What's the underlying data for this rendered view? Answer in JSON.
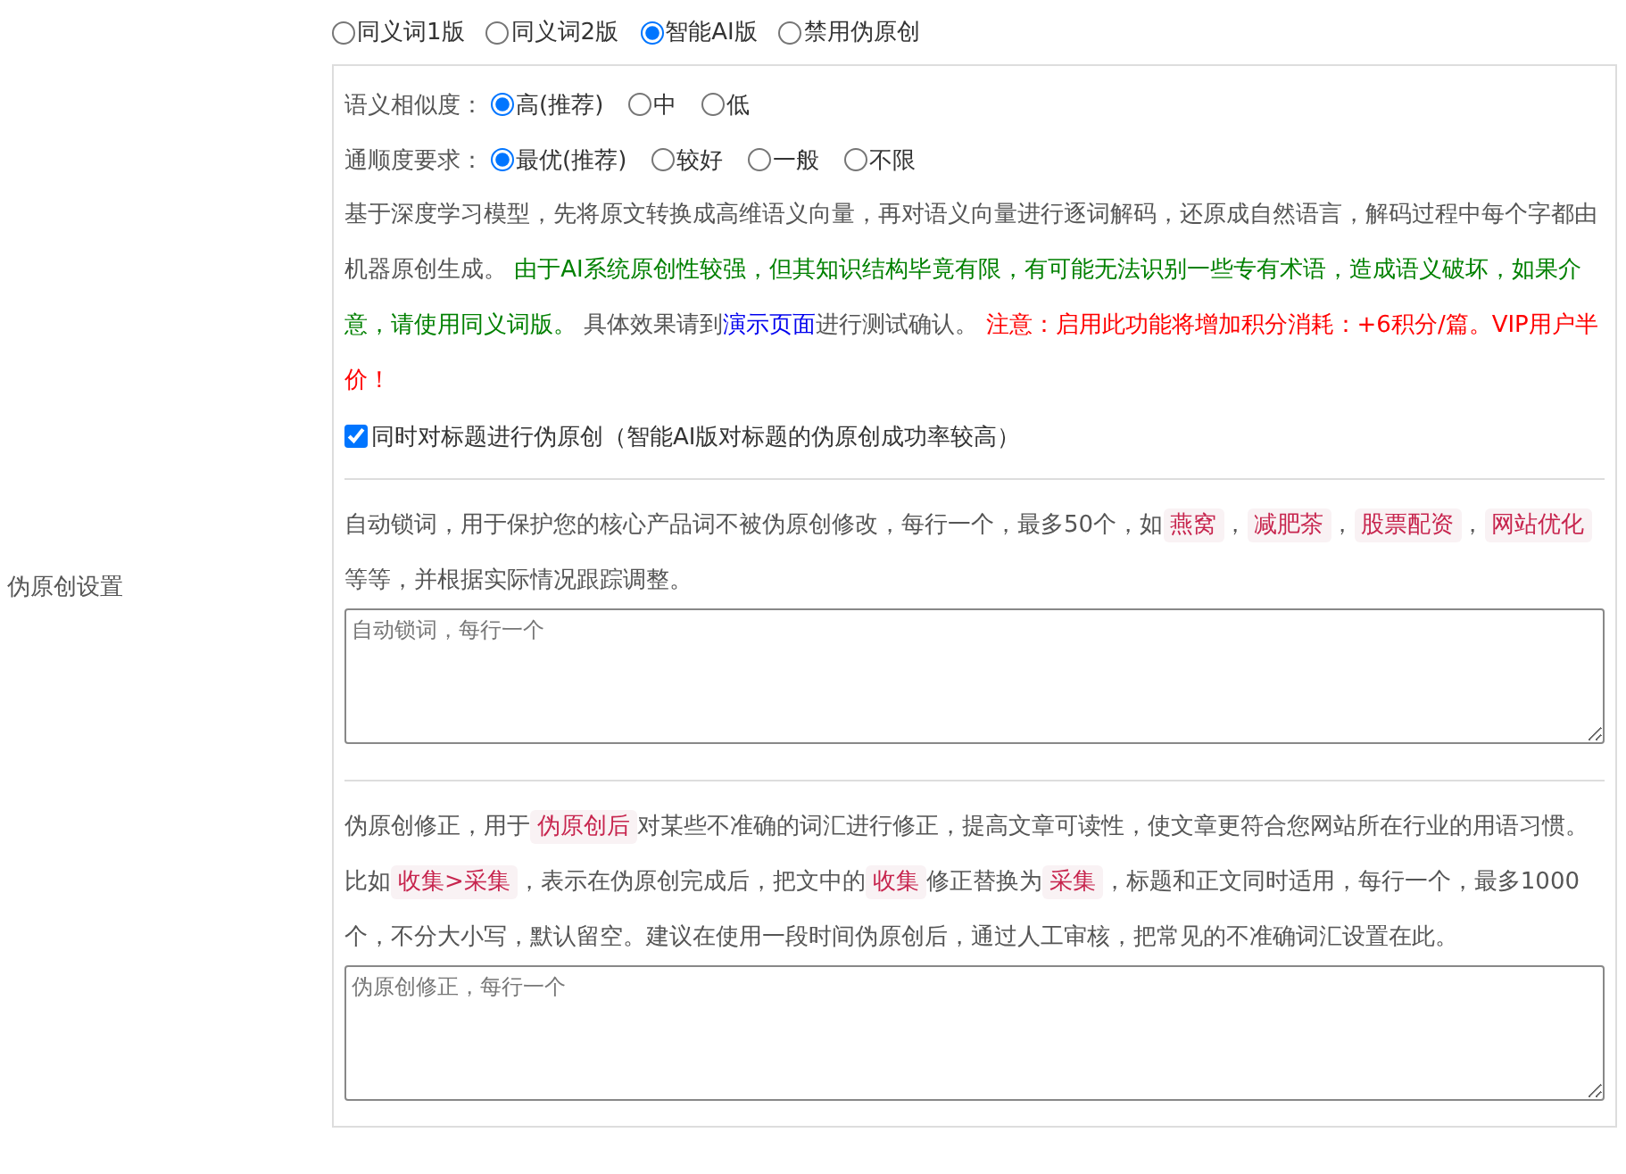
{
  "side_label": "伪原创设置",
  "modes": [
    {
      "label": "同义词1版",
      "selected": false
    },
    {
      "label": "同义词2版",
      "selected": false
    },
    {
      "label": "智能AI版",
      "selected": true
    },
    {
      "label": "禁用伪原创",
      "selected": false
    }
  ],
  "similarity": {
    "label": "语义相似度：",
    "options": [
      {
        "label": "高(推荐)",
        "selected": true
      },
      {
        "label": "中",
        "selected": false
      },
      {
        "label": "低",
        "selected": false
      }
    ]
  },
  "fluency": {
    "label": "通顺度要求：",
    "options": [
      {
        "label": "最优(推荐)",
        "selected": true
      },
      {
        "label": "较好",
        "selected": false
      },
      {
        "label": "一般",
        "selected": false
      },
      {
        "label": "不限",
        "selected": false
      }
    ]
  },
  "ai_note": [
    {
      "kind": "plain",
      "text": "基于深度学习模型，先将原文转换成高维语义向量，再对语义向量进行逐词解码，还原成自然语言，解码过程中每个字都由机器原创生成。 "
    },
    {
      "kind": "green",
      "text": "由于AI系统原创性较强，但其知识结构毕竟有限，有可能无法识别一些专有术语，造成语义破坏，如果介意，请使用同义词版。"
    },
    {
      "kind": "plain",
      "text": " 具体效果请到"
    },
    {
      "kind": "link",
      "text": "演示页面"
    },
    {
      "kind": "plain",
      "text": "进行测试确认。 "
    },
    {
      "kind": "red",
      "text": "注意：启用此功能将增加积分消耗：+6积分/篇。VIP用户半价！"
    }
  ],
  "title_option": {
    "label": "同时对标题进行伪原创（智能AI版对标题的伪原创成功率较高）",
    "checked": true
  },
  "lock_words": {
    "text": [
      {
        "kind": "plain",
        "text": "自动锁词，用于保护您的核心产品词不被伪原创修改，每行一个，最多50个，如"
      },
      {
        "kind": "tag",
        "text": "燕窝"
      },
      {
        "kind": "plain",
        "text": "，"
      },
      {
        "kind": "tag",
        "text": "减肥茶"
      },
      {
        "kind": "plain",
        "text": "，"
      },
      {
        "kind": "tag",
        "text": "股票配资"
      },
      {
        "kind": "plain",
        "text": "，"
      },
      {
        "kind": "tag",
        "text": "网站优化"
      },
      {
        "kind": "plain",
        "text": " 等等，并根据实际情况跟踪调整。"
      }
    ],
    "placeholder": "自动锁词，每行一个"
  },
  "correction": {
    "text": [
      {
        "kind": "plain",
        "text": "伪原创修正，用于"
      },
      {
        "kind": "tag",
        "text": "伪原创后"
      },
      {
        "kind": "plain",
        "text": "对某些不准确的词汇进行修正，提高文章可读性，使文章更符合您网站所在行业的用语习惯。比如"
      },
      {
        "kind": "tag",
        "text": "收集>采集"
      },
      {
        "kind": "plain",
        "text": "，表示在伪原创完成后，把文中的"
      },
      {
        "kind": "tag",
        "text": "收集"
      },
      {
        "kind": "plain",
        "text": "修正替换为"
      },
      {
        "kind": "tag",
        "text": "采集"
      },
      {
        "kind": "plain",
        "text": "，标题和正文同时适用，每行一个，最多1000个，不分大小写，默认留空。建议在使用一段时间伪原创后，通过人工审核，把常见的不准确词汇设置在此。"
      }
    ],
    "placeholder": "伪原创修正，每行一个"
  }
}
